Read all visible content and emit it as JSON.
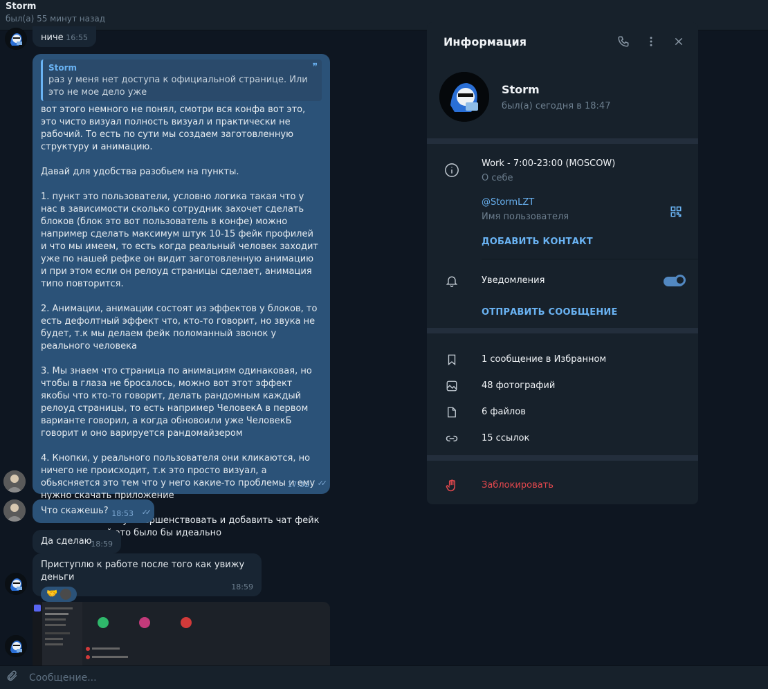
{
  "header": {
    "title": "Storm",
    "subtitle": "был(а) 55 минут назад"
  },
  "messages": {
    "m1": {
      "text": "ниче",
      "time": "16:55"
    },
    "m2": {
      "quote_name": "Storm",
      "quote_text": "раз у меня нет доступа к официальной странице. Или это не мое дело уже",
      "paragraphs": [
        "вот этого немного не понял, смотри вся конфа вот это, это чисто визуал полность визуал и практически не рабочий. То есть по сути мы создаем заготовленную структуру и анимацию.",
        "Давай для удобства разобьем на пункты.",
        "1. пункт это пользователи, условно логика такая что у нас в зависимости сколько сотрудник захочет сделать блоков (блок это вот пользователь в конфе) можно например сделать максимум штук 10-15 фейк профилей и что мы имеем, то есть когда реальный человек заходит уже по нашей рефке он видит заготовленную анимацию и при этом если он релоуд страницы сделает, анимация типо повторится.",
        "2. Анимации, анимации состоят из эффектов у блоков, то есть дефолтный эффект что, кто-то говорит, но звука не будет, т.к мы делаем фейк поломанный звонок у реального человека",
        "3. Мы знаем что страница по анимациям одинаковая, но чтобы в глаза не бросалось, можно вот этот эффект якобы что кто-то говорит, делать рандомным каждый релоуд страницы, то есть например ЧеловекА в первом варианте говорил, а когда обновоили уже ЧеловекБ говорит и оно варируется рандомайзером",
        "4. Кнопки, у реального пользователя они кликаются, но ничего не происходит, т.к это просто визуал, а обьясняется это тем что у него какие-то проблемы и ему нужно скачать приложение",
        "5. Так же можно усовершенствовать и добавить чат фейк пользователей это было бы идеально"
      ],
      "time": "17:32"
    },
    "m3": {
      "text": "Что скажешь?",
      "time": "18:53"
    },
    "m4": {
      "text": "Да сделаю",
      "time": "18:59"
    },
    "m5": {
      "text": "Приступлю к работе после того как увижу деньги",
      "time": "18:59",
      "reaction": "🤝"
    }
  },
  "composer": {
    "placeholder": "Сообщение..."
  },
  "panel": {
    "title": "Информация",
    "name": "Storm",
    "status": "был(а) сегодня в 18:47",
    "bio": "Work - 7:00-23:00 (MOSCOW)",
    "bio_label": "О себе",
    "username": "@StormLZT",
    "username_label": "Имя пользователя",
    "add_contact": "ДОБАВИТЬ КОНТАКТ",
    "notifications": "Уведомления",
    "notifications_on": true,
    "send_message": "ОТПРАВИТЬ СООБЩЕНИЕ",
    "media": [
      {
        "icon": "bookmark-icon",
        "label": "1 сообщение в Избранном"
      },
      {
        "icon": "photo-icon",
        "label": "48 фотографий"
      },
      {
        "icon": "file-icon",
        "label": "6 файлов"
      },
      {
        "icon": "link-icon",
        "label": "15 ссылок"
      }
    ],
    "block": "Заблокировать"
  },
  "colors": {
    "background": "#0e1621",
    "bubble_in": "#182533",
    "bubble_out": "#2b5278",
    "accent": "#6ab3f3",
    "danger": "#e5484d"
  }
}
